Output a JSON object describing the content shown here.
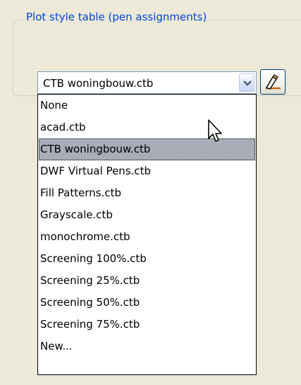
{
  "group": {
    "title": "Plot style table (pen assignments)"
  },
  "combo": {
    "selected_value": "CTB woningbouw.ctb",
    "arrow_icon": "chevron-down-icon"
  },
  "edit_button": {
    "icon": "pencil-edit-icon"
  },
  "dropdown": {
    "selected_index": 2,
    "items": [
      {
        "label": "None"
      },
      {
        "label": "acad.ctb"
      },
      {
        "label": "CTB woningbouw.ctb"
      },
      {
        "label": "DWF Virtual Pens.ctb"
      },
      {
        "label": "Fill Patterns.ctb"
      },
      {
        "label": "Grayscale.ctb"
      },
      {
        "label": "monochrome.ctb"
      },
      {
        "label": "Screening 100%.ctb"
      },
      {
        "label": "Screening 25%.ctb"
      },
      {
        "label": "Screening 50%.ctb"
      },
      {
        "label": "Screening 75%.ctb"
      },
      {
        "label": "New..."
      }
    ]
  },
  "colors": {
    "title_blue": "#0046d5",
    "selection": "#a9adb8",
    "background": "#ece9d8"
  }
}
